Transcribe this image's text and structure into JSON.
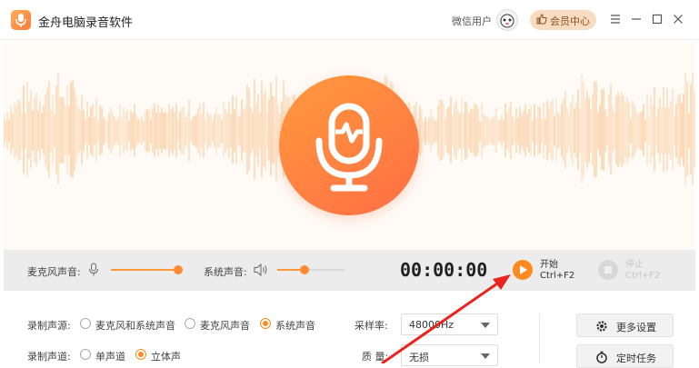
{
  "app": {
    "title": "金舟电脑录音软件"
  },
  "user": {
    "name": "微信用户"
  },
  "vip": {
    "label": "会员中心"
  },
  "window_controls": [
    "menu-icon",
    "minimize-icon",
    "maximize-icon",
    "close-icon"
  ],
  "colors": {
    "accent": "#ff8a1f",
    "wave": "#fbc894",
    "mic_gradient_start": "#ff9a3c",
    "mic_gradient_end": "#ff6e45"
  },
  "controls": {
    "mic_label": "麦克风声音:",
    "mic_level": 0.97,
    "system_label": "系统声音:",
    "system_level": 0.4,
    "timer": "00:00:00",
    "start_label": "开始",
    "start_shortcut": "Ctrl+F2",
    "stop_label": "停止",
    "stop_shortcut": "Ctrl+F2"
  },
  "settings": {
    "source_label": "录制声源:",
    "source_options": [
      "麦克风和系统声音",
      "麦克风声音",
      "系统声音"
    ],
    "source_selected": "系统声音",
    "channel_label": "录制声道:",
    "channel_options": [
      "单声道",
      "立体声"
    ],
    "channel_selected": "立体声",
    "sample_rate_label": "采样率:",
    "sample_rate_value": "48000Hz",
    "quality_label": "质 量:",
    "quality_value": "无损",
    "more_settings": "更多设置",
    "scheduled_task": "定时任务"
  }
}
